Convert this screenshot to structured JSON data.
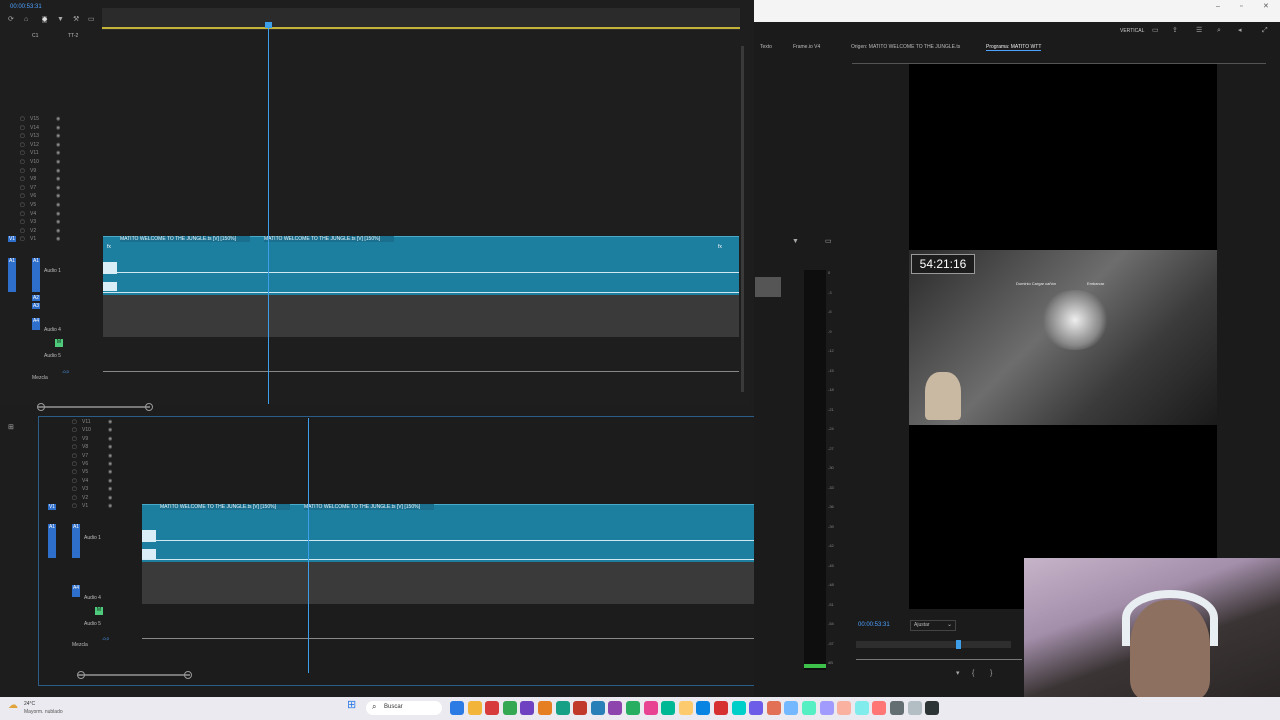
{
  "top_timeline": {
    "timecode": "00:00:53:31",
    "sync_label": "C1",
    "target_label": "TT-2",
    "video_tracks": [
      "V15",
      "V14",
      "V13",
      "V12",
      "V11",
      "V10",
      "V9",
      "V8",
      "V7",
      "V6",
      "V5",
      "V4",
      "V3",
      "V2",
      "V1"
    ],
    "clip_title_1": "MATITO WELCOME TO THE JUNGLE.ts [V] [150%]",
    "clip_title_2": "MATITO WELCOME TO THE JUNGLE.ts [V] [150%]",
    "audio_tracks": [
      "Audio 1",
      "Audio 4",
      "Audio 5"
    ],
    "audio_track_ids": [
      "A1",
      "A2",
      "A3",
      "A4",
      "A5"
    ],
    "mix_label": "Mezcla",
    "mix_value": "-0,0"
  },
  "bottom_timeline": {
    "video_tracks": [
      "V11",
      "V10",
      "V9",
      "V8",
      "V7",
      "V6",
      "V5",
      "V4",
      "V3",
      "V2",
      "V1"
    ],
    "clip_title_1": "MATITO WELCOME TO THE JUNGLE.ts [V] [150%]",
    "clip_title_2": "MATITO WELCOME TO THE JUNGLE.ts [V] [150%]",
    "audio_tracks": [
      "Audio 1",
      "Audio 4",
      "Audio 5"
    ],
    "mix_label": "Mezcla",
    "mix_value": "-0,0"
  },
  "right_panel": {
    "header_label": "VERTICAL",
    "tabs_left": [
      "Texto",
      "Frame.io V4"
    ],
    "tabs_right": [
      "Origen: MATITO WELCOME TO THE JUNGLE.ts",
      "Programa: MATITO WTT"
    ],
    "meter_scale": [
      "0",
      "-3",
      "-6",
      "-9",
      "-12",
      "-15",
      "-18",
      "-21",
      "-24",
      "-27",
      "-30",
      "-33",
      "-36",
      "-39",
      "-42",
      "-45",
      "-48",
      "-51",
      "-54",
      "-57",
      "dB"
    ],
    "program_timecode": "00:00:53:31",
    "fit_label": "Ajustar",
    "overlay_timecode": "54:21:16",
    "overlay_game_text": [
      "Dominio Cargar cañón",
      "Embarcar"
    ]
  },
  "taskbar": {
    "weather_line1": "24°C",
    "weather_line2": "Mayorm. nublado",
    "search_label": "Buscar",
    "app_colors": [
      "#2c7be5",
      "#f2b53a",
      "#d83b3b",
      "#35a853",
      "#6f42c1",
      "#e67e22",
      "#16a085",
      "#c0392b",
      "#2980b9",
      "#8e44ad",
      "#27ae60",
      "#e84393",
      "#00b894",
      "#fdcb6e",
      "#0984e3",
      "#d63031",
      "#00cec9",
      "#6c5ce7",
      "#e17055",
      "#74b9ff",
      "#55efc4",
      "#a29bfe",
      "#fab1a0",
      "#81ecec",
      "#ff7675",
      "#636e72",
      "#b2bec3",
      "#2d3436"
    ]
  },
  "colors": {
    "clip": "#1c7fa0",
    "clip_head": "#1b6f8e",
    "playhead": "#3d9ee9",
    "track_badge": "#2f6fcc",
    "mute_badge": "#4fc97b"
  }
}
